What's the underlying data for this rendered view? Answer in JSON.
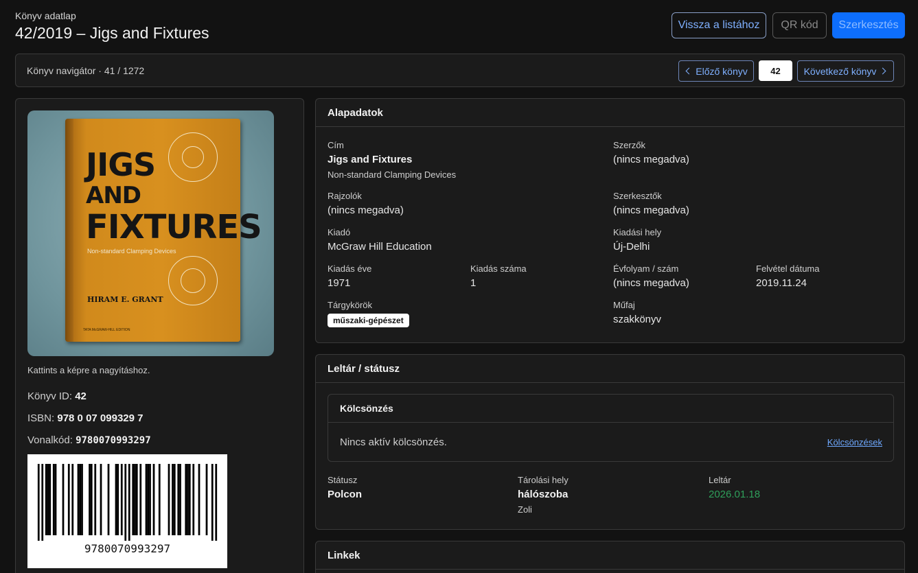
{
  "header": {
    "supertitle": "Könyv adatlap",
    "title": "42/2019 – Jigs and Fixtures",
    "back_label": "Vissza a listához",
    "qr_label": "QR kód",
    "edit_label": "Szerkesztés"
  },
  "navigator": {
    "label": "Könyv navigátor · 41 / 1272",
    "prev_label": "Előző könyv",
    "current_value": "42",
    "next_label": "Következő könyv"
  },
  "left": {
    "cover": {
      "title_line1": "JIGS",
      "title_line2": "AND",
      "title_line3": "FIXTURES",
      "subtitle": "Non-standard Clamping Devices",
      "author": "HIRAM E. GRANT",
      "publisher": "TATA McGRAW-HILL EDITION"
    },
    "hint": "Kattints a képre a nagyításhoz.",
    "id_label": "Könyv ID:",
    "id_value": "42",
    "isbn_label": "ISBN:",
    "isbn_value": "978 0 07 099329 7",
    "barcode_label": "Vonalkód:",
    "barcode_value": "9780070993297"
  },
  "basic": {
    "heading": "Alapadatok",
    "title_label": "Cím",
    "title_value": "Jigs and Fixtures",
    "subtitle_value": "Non-standard Clamping Devices",
    "authors_label": "Szerzők",
    "authors_value": "(nincs megadva)",
    "illustrators_label": "Rajzolók",
    "illustrators_value": "(nincs megadva)",
    "editors_label": "Szerkesztők",
    "editors_value": "(nincs megadva)",
    "publisher_label": "Kiadó",
    "publisher_value": "McGraw Hill Education",
    "place_label": "Kiadási hely",
    "place_value": "Új-Delhi",
    "year_label": "Kiadás éve",
    "year_value": "1971",
    "edition_label": "Kiadás száma",
    "edition_value": "1",
    "volume_label": "Évfolyam / szám",
    "volume_value": "(nincs megadva)",
    "added_label": "Felvétel dátuma",
    "added_value": "2019.11.24",
    "subjects_label": "Tárgykörök",
    "subject_tag": "műszaki-gépészet",
    "genre_label": "Műfaj",
    "genre_value": "szakkönyv"
  },
  "inventory": {
    "heading": "Leltár / státusz",
    "loan_heading": "Kölcsönzés",
    "loan_text": "Nincs aktív kölcsönzés.",
    "loan_link": "Kölcsönzések",
    "status_label": "Státusz",
    "status_value": "Polcon",
    "storage_label": "Tárolási hely",
    "storage_value": "hálószoba",
    "storage_sub": "Zoli",
    "inventory_label": "Leltár",
    "inventory_value": "2026.01.18",
    "inventory_color": "#2f9e5a"
  },
  "links": {
    "heading": "Linkek"
  }
}
